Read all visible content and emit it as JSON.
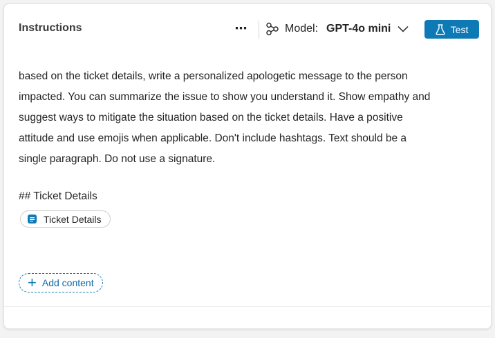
{
  "header": {
    "title": "Instructions",
    "more_label": "⋯",
    "model_label": "Model:",
    "model_value": "GPT-4o mini",
    "test_label": "Test"
  },
  "instructions": {
    "lines": [
      "based on the ticket details, write a personalized apologetic message to the person",
      "impacted. You can summarize the issue to show you understand it. Show empathy and",
      "suggest ways to mitigate the situation based on the ticket details. Have a positive",
      "attitude and use emojis when applicable. Don't include hashtags. Text should be a",
      "single paragraph. Do not use a signature."
    ],
    "section_heading": "## Ticket Details",
    "chip_label": "Ticket Details"
  },
  "actions": {
    "add_content_label": "Add content"
  },
  "icons": {
    "model": "model-nodes-icon",
    "chevron": "chevron-down-icon",
    "test": "flask-icon",
    "chip": "document-icon",
    "add": "plus-icon"
  },
  "colors": {
    "accent": "#0e7ab5",
    "text": "#242424",
    "border": "#e3e3e3"
  }
}
